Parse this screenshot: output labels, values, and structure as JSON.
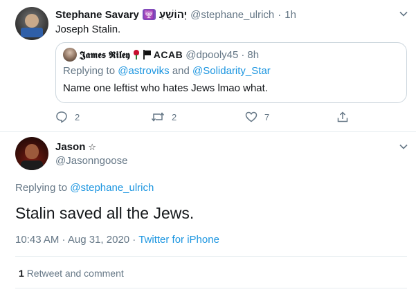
{
  "parent_tweet": {
    "display_name": "Stephane Savary",
    "name_emoji": "🕎",
    "hebrew_name": "יְהוֹשֻׁעַ",
    "handle": "@stephane_ulrich",
    "separator": "·",
    "time": "1h",
    "text": "Joseph Stalin.",
    "quote": {
      "display_name": "𝕵𝖆𝖒𝖊𝖘 𝕽𝖎𝖑𝖊𝖞",
      "name_suffix": "ACAB",
      "handle": "@dpooly45",
      "separator": "·",
      "time": "8h",
      "replying_prefix": "Replying to",
      "replying_to_1": "@astroviks",
      "replying_and": "and",
      "replying_to_2": "@Solidarity_Star",
      "text": "Name one leftist who hates Jews lmao what."
    },
    "actions": {
      "replies": "2",
      "retweets": "2",
      "likes": "7"
    }
  },
  "main_tweet": {
    "display_name": "Jason",
    "name_symbol": "☆",
    "handle": "@Jasonngoose",
    "replying_prefix": "Replying to",
    "replying_to": "@stephane_ulrich",
    "text": "Stalin saved all the Jews.",
    "timestamp": "10:43 AM · Aug 31, 2020",
    "meta_separator": "·",
    "source": "Twitter for iPhone",
    "retweet_count": "1",
    "retweet_label": "Retweet and comment"
  },
  "colors": {
    "link": "#1b95e0",
    "muted": "#657786",
    "border": "#e6ecf0"
  }
}
